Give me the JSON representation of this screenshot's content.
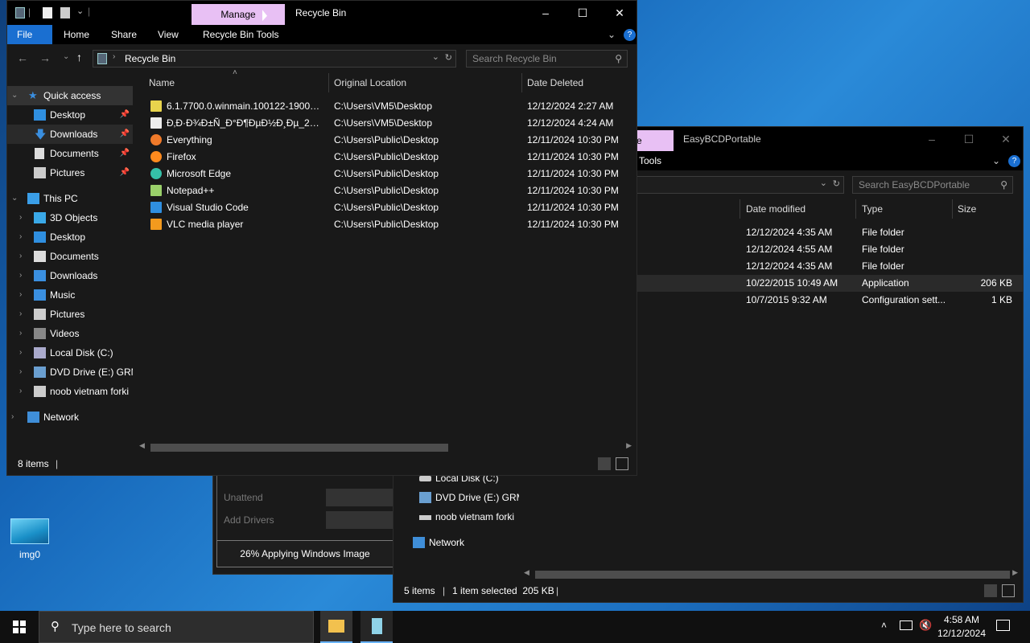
{
  "desktop": {
    "icon_label": "img0"
  },
  "bg_window": {
    "title": "EasyBCDPortable",
    "manage_tab": "e",
    "tools_tab": "Tools",
    "search_placeholder": "Search EasyBCDPortable",
    "columns": [
      "Date modified",
      "Type",
      "Size"
    ],
    "rows": [
      {
        "date": "12/12/2024 4:35 AM",
        "type": "File folder",
        "size": ""
      },
      {
        "date": "12/12/2024 4:55 AM",
        "type": "File folder",
        "size": ""
      },
      {
        "date": "12/12/2024 4:35 AM",
        "type": "File folder",
        "size": ""
      },
      {
        "date": "10/22/2015 10:49 AM",
        "type": "Application",
        "size": "206 KB"
      },
      {
        "date": "10/7/2015 9:32 AM",
        "type": "Configuration sett...",
        "size": "1 KB"
      }
    ],
    "nav": [
      "Local Disk (C:)",
      "DVD Drive (E:) GRM",
      "noob vietnam forki",
      "Network"
    ],
    "status": {
      "items": "5 items",
      "selected": "1 item selected  205 KB"
    }
  },
  "installer": {
    "row1": "Unattend",
    "row2": "Add Drivers",
    "progress_label": "26% Applying Windows Image"
  },
  "main_window": {
    "title": "Recycle Bin",
    "manage_tab": "Manage",
    "ribbon_tabs": {
      "file": "File",
      "home": "Home",
      "share": "Share",
      "view": "View",
      "tools": "Recycle Bin Tools"
    },
    "address": "Recycle Bin",
    "search_placeholder": "Search Recycle Bin",
    "columns": {
      "name": "Name",
      "location": "Original Location",
      "date": "Date Deleted"
    },
    "rows": [
      {
        "name": "6.1.7700.0.winmain.100122-1900_a...",
        "location": "C:\\Users\\VM5\\Desktop",
        "date": "12/12/2024 2:27 AM",
        "icon": "archive-icon"
      },
      {
        "name": "Ð‚Ð·Ð¾Ð±Ñ_Ð°Ð¶ÐµÐ½Ð¸Ðµ_2024...",
        "location": "C:\\Users\\VM5\\Desktop",
        "date": "12/12/2024 4:24 AM",
        "icon": "document-icon"
      },
      {
        "name": "Everything",
        "location": "C:\\Users\\Public\\Desktop",
        "date": "12/11/2024 10:30 PM",
        "icon": "everything-icon"
      },
      {
        "name": "Firefox",
        "location": "C:\\Users\\Public\\Desktop",
        "date": "12/11/2024 10:30 PM",
        "icon": "firefox-icon"
      },
      {
        "name": "Microsoft Edge",
        "location": "C:\\Users\\Public\\Desktop",
        "date": "12/11/2024 10:30 PM",
        "icon": "edge-icon"
      },
      {
        "name": "Notepad++",
        "location": "C:\\Users\\Public\\Desktop",
        "date": "12/11/2024 10:30 PM",
        "icon": "notepadpp-icon"
      },
      {
        "name": "Visual Studio Code",
        "location": "C:\\Users\\Public\\Desktop",
        "date": "12/11/2024 10:30 PM",
        "icon": "vscode-icon"
      },
      {
        "name": "VLC media player",
        "location": "C:\\Users\\Public\\Desktop",
        "date": "12/11/2024 10:30 PM",
        "icon": "vlc-icon"
      }
    ],
    "nav": {
      "quick_access": "Quick access",
      "qa_desktop": "Desktop",
      "qa_downloads": "Downloads",
      "qa_documents": "Documents",
      "qa_pictures": "Pictures",
      "this_pc": "This PC",
      "objects3d": "3D Objects",
      "desktop": "Desktop",
      "documents": "Documents",
      "downloads": "Downloads",
      "music": "Music",
      "pictures": "Pictures",
      "videos": "Videos",
      "local_disk": "Local Disk (C:)",
      "dvd_drive": "DVD Drive (E:) GRM",
      "net_drive": "noob vietnam forki",
      "network": "Network"
    },
    "status": {
      "items": "8 items"
    }
  },
  "taskbar": {
    "search_placeholder": "Type here to search",
    "time": "4:58 AM",
    "date": "12/12/2024"
  },
  "colors": {
    "accent": "#1a6fd1",
    "manage_tab": "#e8c0f4",
    "window_bg": "#191919",
    "title_bg": "#000000"
  }
}
